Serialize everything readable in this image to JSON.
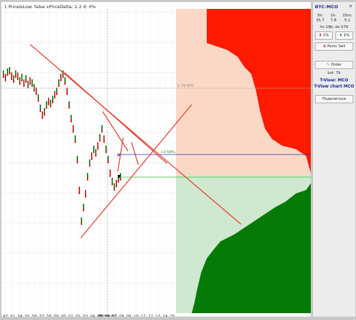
{
  "window": {
    "title": "1 PriceIsLow: false xPriceDelta: 2.2 d: 0%"
  },
  "chart": {
    "x_ticks": [
      "47",
      "51",
      "54",
      "55",
      "56",
      "57",
      "58",
      "59",
      "00",
      "01",
      "02",
      "03",
      "04",
      "05",
      "06",
      "07",
      "08",
      "09",
      "10",
      "11",
      "12",
      "13",
      "14",
      "15"
    ],
    "current_time": "08:06:07",
    "level_labels": {
      "btc_level": "1.79 BTC",
      "percent_level": "+0.68%"
    },
    "colors": {
      "ask_fill": "#ff1a00",
      "ask_bg": "#fbd8c6",
      "bid_fill": "#067a06",
      "bid_bg": "#cfe8cf",
      "trend_line": "#e04030",
      "blue_line": "#2a2ab0",
      "green_line": "#5ad05a",
      "candle_up": "#1a7a1a",
      "candle_down": "#cc2020"
    }
  },
  "panel": {
    "pair": "BTC-MCO",
    "close_icon": "×",
    "timeframes": [
      {
        "label": "3h:",
        "value": "15.7"
      },
      {
        "label": "1h:",
        "value": "7.8"
      },
      {
        "label": "15m:",
        "value": "5.1"
      }
    ],
    "volume_text": "hv 18k; dv 579",
    "pct_down": "1%",
    "pct_up": "1%",
    "panic_sell": "Panic Sell",
    "order": "Order",
    "lot": "Lot: 7$",
    "tview": "T-View: MCO",
    "tview_chart": "T-View chart MCO",
    "share": "Поделиться"
  }
}
